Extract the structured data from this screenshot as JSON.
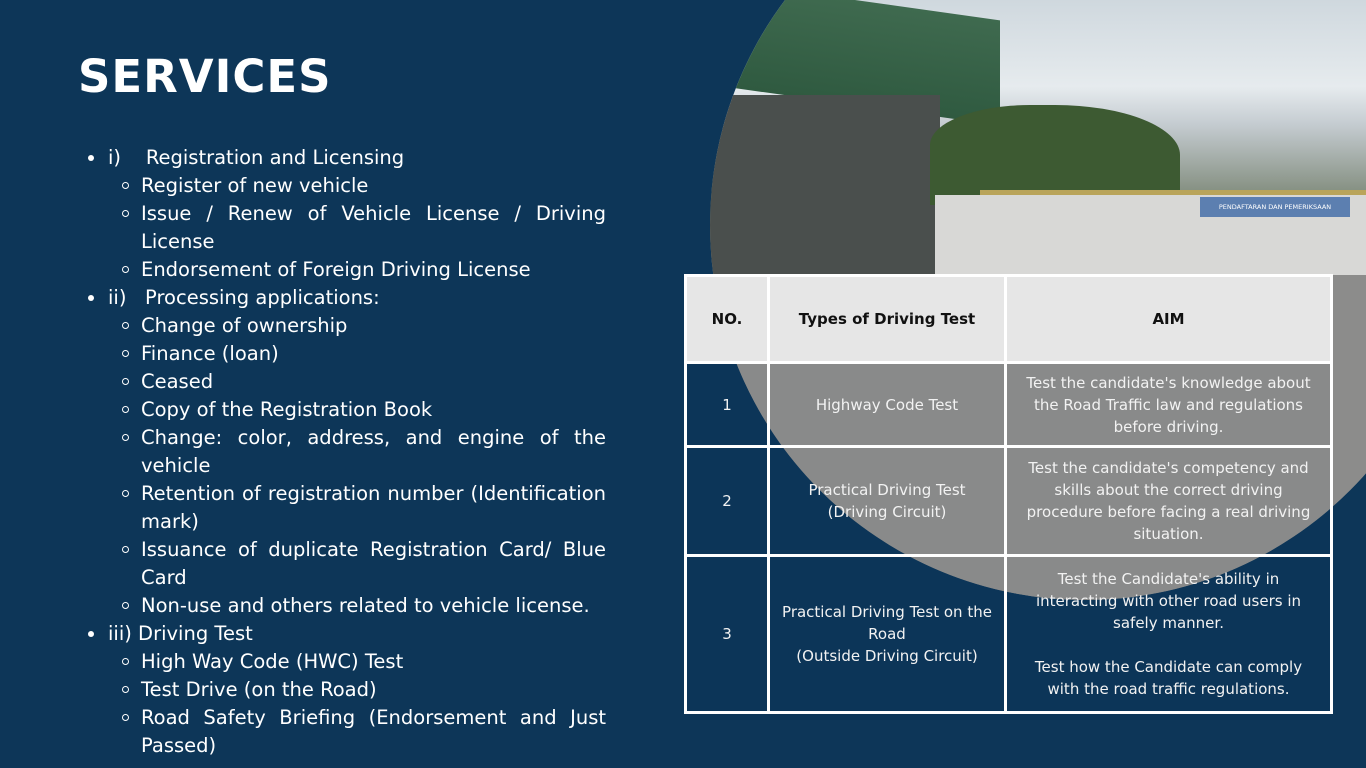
{
  "title": "SERVICES",
  "services": [
    {
      "label": "i)    Registration and Licensing",
      "items": [
        "Register of new vehicle",
        "Issue / Renew of Vehicle License / Driving License",
        "Endorsement of Foreign Driving License"
      ]
    },
    {
      "label": "ii)   Processing applications:",
      "items": [
        "Change of ownership",
        "Finance (loan)",
        "Ceased",
        "Copy of the Registration Book",
        "Change: color, address, and engine of the vehicle",
        "Retention of registration number (Identification mark)",
        "Issuance of duplicate Registration Card/ Blue Card",
        "Non-use and others related to vehicle license."
      ]
    },
    {
      "label": "iii) Driving Test",
      "items": [
        "High Way Code (HWC) Test",
        "Test Drive (on the Road)",
        "Road Safety Briefing (Endorsement and Just Passed)"
      ]
    }
  ],
  "table": {
    "headers": [
      "NO.",
      "Types of Driving Test",
      "AIM"
    ],
    "rows": [
      [
        "1",
        "Highway Code Test",
        "Test the candidate's knowledge about the Road Traffic law and regulations before driving."
      ],
      [
        "2",
        "Practical Driving Test\n(Driving Circuit)",
        "Test the candidate's competency and skills about the correct driving procedure before facing a real driving situation."
      ],
      [
        "3",
        "Practical Driving Test on the Road\n(Outside Driving Circuit)",
        "Test the Candidate's ability in interacting with other road users in safely manner.\n\nTest how the Candidate can comply with the road traffic regulations."
      ]
    ]
  },
  "photo_sign": "PENDAFTARAN DAN PEMERIKSAAN",
  "colors": {
    "background": "#0d3658",
    "header_bg": "#e6e6e6"
  }
}
